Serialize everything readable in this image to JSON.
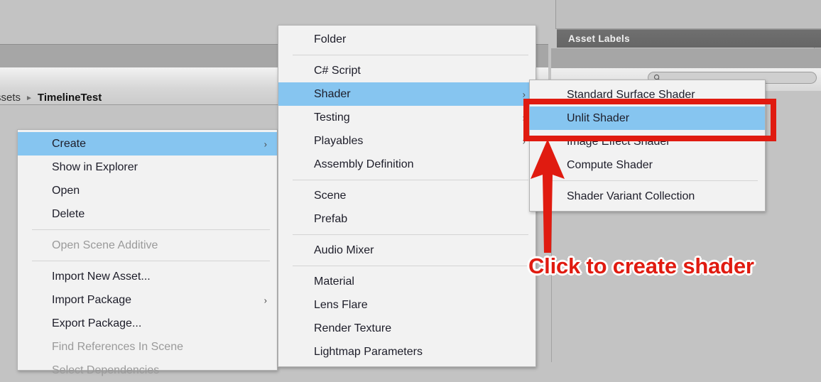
{
  "app": {
    "background_color": "#c3c3c3",
    "highlight_color": "#86c5f0",
    "menu_background_color": "#f2f2f2",
    "annotation_color": "#e01b10"
  },
  "project_panel": {
    "breadcrumb": {
      "root_label": "ssets",
      "separator": "►",
      "current_label": "TimelineTest"
    }
  },
  "inspector_panel": {
    "asset_labels_header": "Asset Labels",
    "search": {
      "value": "",
      "placeholder": "",
      "icon": "search-icon"
    }
  },
  "context_menu": {
    "items": [
      {
        "label": "Create",
        "selected": true,
        "disabled": false,
        "submenu": true,
        "separator_after": false
      },
      {
        "label": "Show in Explorer",
        "selected": false,
        "disabled": false,
        "submenu": false,
        "separator_after": false
      },
      {
        "label": "Open",
        "selected": false,
        "disabled": false,
        "submenu": false,
        "separator_after": false
      },
      {
        "label": "Delete",
        "selected": false,
        "disabled": false,
        "submenu": false,
        "separator_after": true
      },
      {
        "label": "Open Scene Additive",
        "selected": false,
        "disabled": true,
        "submenu": false,
        "separator_after": true
      },
      {
        "label": "Import New Asset...",
        "selected": false,
        "disabled": false,
        "submenu": false,
        "separator_after": false
      },
      {
        "label": "Import Package",
        "selected": false,
        "disabled": false,
        "submenu": true,
        "separator_after": false
      },
      {
        "label": "Export Package...",
        "selected": false,
        "disabled": false,
        "submenu": false,
        "separator_after": false
      },
      {
        "label": "Find References In Scene",
        "selected": false,
        "disabled": true,
        "submenu": false,
        "separator_after": false
      },
      {
        "label": "Select Dependencies",
        "selected": false,
        "disabled": true,
        "submenu": false,
        "separator_after": false
      }
    ]
  },
  "create_menu": {
    "items": [
      {
        "label": "Folder",
        "selected": false,
        "disabled": false,
        "submenu": false,
        "separator_after": true
      },
      {
        "label": "C# Script",
        "selected": false,
        "disabled": false,
        "submenu": false,
        "separator_after": false
      },
      {
        "label": "Shader",
        "selected": true,
        "disabled": false,
        "submenu": true,
        "separator_after": false
      },
      {
        "label": "Testing",
        "selected": false,
        "disabled": false,
        "submenu": true,
        "separator_after": false
      },
      {
        "label": "Playables",
        "selected": false,
        "disabled": false,
        "submenu": true,
        "separator_after": false
      },
      {
        "label": "Assembly Definition",
        "selected": false,
        "disabled": false,
        "submenu": false,
        "separator_after": true
      },
      {
        "label": "Scene",
        "selected": false,
        "disabled": false,
        "submenu": false,
        "separator_after": false
      },
      {
        "label": "Prefab",
        "selected": false,
        "disabled": false,
        "submenu": false,
        "separator_after": true
      },
      {
        "label": "Audio Mixer",
        "selected": false,
        "disabled": false,
        "submenu": false,
        "separator_after": true
      },
      {
        "label": "Material",
        "selected": false,
        "disabled": false,
        "submenu": false,
        "separator_after": false
      },
      {
        "label": "Lens Flare",
        "selected": false,
        "disabled": false,
        "submenu": false,
        "separator_after": false
      },
      {
        "label": "Render Texture",
        "selected": false,
        "disabled": false,
        "submenu": false,
        "separator_after": false
      },
      {
        "label": "Lightmap Parameters",
        "selected": false,
        "disabled": false,
        "submenu": false,
        "separator_after": false
      }
    ]
  },
  "shader_menu": {
    "items": [
      {
        "label": "Standard Surface Shader",
        "selected": false,
        "disabled": false,
        "submenu": false,
        "separator_after": false
      },
      {
        "label": "Unlit Shader",
        "selected": true,
        "disabled": false,
        "submenu": false,
        "separator_after": false
      },
      {
        "label": "Image Effect Shader",
        "selected": false,
        "disabled": false,
        "submenu": false,
        "separator_after": false
      },
      {
        "label": "Compute Shader",
        "selected": false,
        "disabled": false,
        "submenu": false,
        "separator_after": true
      },
      {
        "label": "Shader Variant Collection",
        "selected": false,
        "disabled": false,
        "submenu": false,
        "separator_after": false
      }
    ]
  },
  "annotation": {
    "callout_text": "Click to create shader",
    "highlight_target": "Unlit Shader"
  }
}
